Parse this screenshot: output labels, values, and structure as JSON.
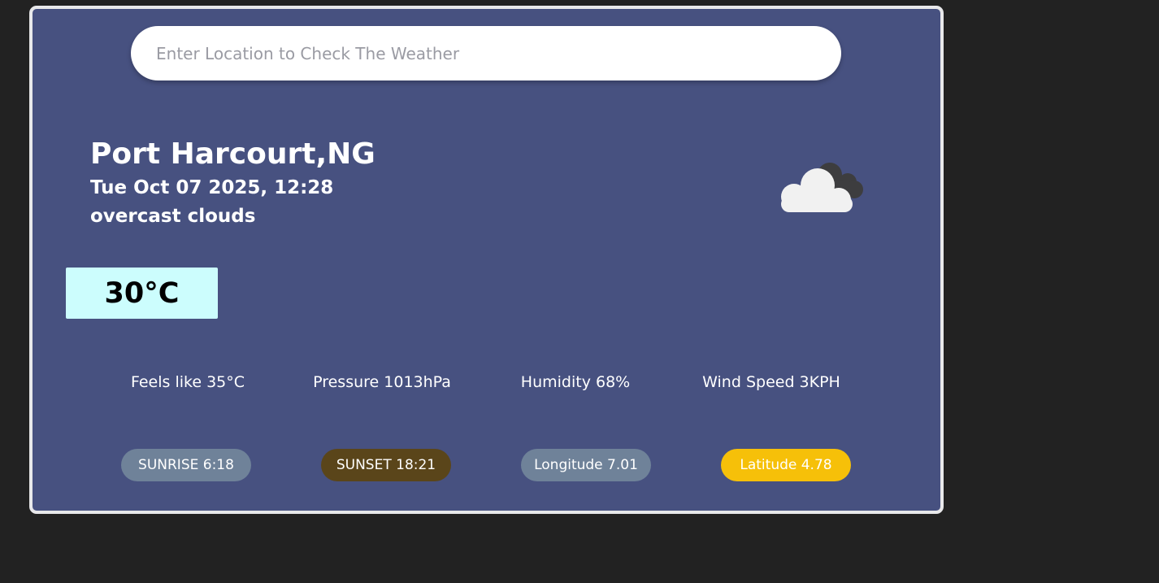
{
  "search": {
    "placeholder": "Enter Location to Check The Weather",
    "value": ""
  },
  "location": {
    "city": "Port Harcourt,NG",
    "datetime": "Tue Oct 07 2025, 12:28",
    "description": "overcast clouds"
  },
  "weather_icon": "overcast-clouds-icon",
  "temperature": "30°C",
  "stats": {
    "feels_like": "Feels like 35°C",
    "pressure": "Pressure 1013hPa",
    "humidity": "Humidity 68%",
    "wind": "Wind Speed 3KPH"
  },
  "badges": {
    "sunrise": "SUNRISE 6:18",
    "sunset": "SUNSET 18:21",
    "longitude": "Longitude 7.01",
    "latitude": "Latitude 4.78"
  },
  "colors": {
    "background": "#222222",
    "card": "#475180",
    "card_border": "#e8e8ea",
    "temp_box": "#ccfdfd",
    "sunrise_badge": "#6f8299",
    "sunset_badge": "#5a451a",
    "longitude_badge": "#6f8299",
    "latitude_badge": "#f6c009"
  }
}
